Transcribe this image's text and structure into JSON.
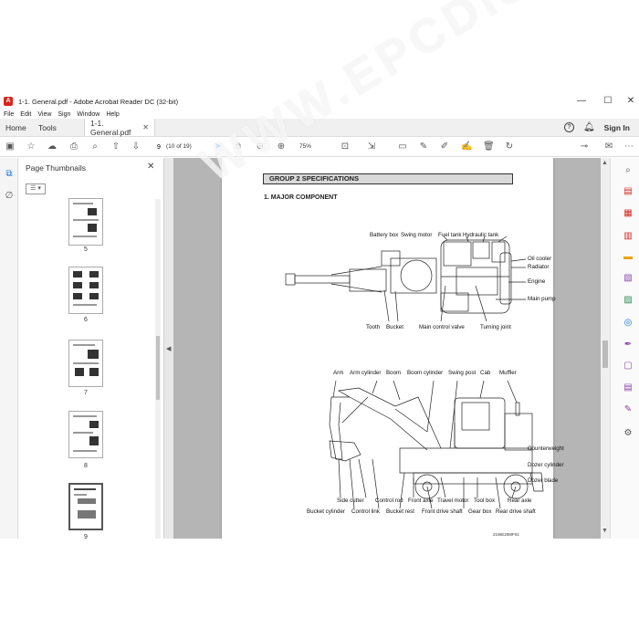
{
  "window": {
    "title": "1-1. General.pdf - Adobe Acrobat Reader DC (32-bit)",
    "app_icon": "acrobat-icon",
    "controls": [
      "—",
      "☐",
      "✕"
    ]
  },
  "menu": [
    "File",
    "Edit",
    "View",
    "Sign",
    "Window",
    "Help"
  ],
  "tabs": {
    "home": "Home",
    "tools": "Tools",
    "document": "1-1. General.pdf",
    "sign_in": "Sign In"
  },
  "toolbar": {
    "page_number": "9",
    "page_of": "(10 of 19)",
    "zoom": "75%"
  },
  "thumbnails": {
    "header": "Page Thumbnails",
    "pages": [
      {
        "label": "5"
      },
      {
        "label": "6"
      },
      {
        "label": "7"
      },
      {
        "label": "8"
      },
      {
        "label": "9"
      }
    ]
  },
  "document": {
    "group_heading": "GROUP  2  SPECIFICATIONS",
    "section_title": "1. MAJOR COMPONENT",
    "top_labels": {
      "battery_box": "Battery box",
      "swing_motor": "Swing motor",
      "fuel_tank": "Fuel tank",
      "hydraulic_tank": "Hydraulic tank",
      "oil_cooler": "Oil cooler",
      "radiator": "Radiator",
      "engine": "Engine",
      "main_pump": "Main pump",
      "tooth": "Tooth",
      "bucket": "Bucket",
      "main_control_valve": "Main control valve",
      "turning_joint": "Turning joint"
    },
    "side_labels": {
      "arm": "Arm",
      "arm_cylinder": "Arm cylinder",
      "boom": "Boom",
      "boom_cylinder": "Boom cylinder",
      "swing_post": "Swing post",
      "cab": "Cab",
      "muffler": "Muffler",
      "counterweight": "Counterweight",
      "dozer_cylinder": "Dozer cylinder",
      "dozer_blade": "Dozer blade",
      "side_cutter": "Side cutter",
      "control_rod": "Control rod",
      "front_axle": "Front axle",
      "travel_motor": "Travel motor",
      "tool_box": "Tool box",
      "rear_axle": "Rear axle",
      "bucket_cylinder": "Bucket cylinder",
      "control_link": "Control link",
      "bucket_rest": "Bucket rest",
      "front_drive_shaft": "Front drive shaft",
      "gear_box": "Gear box",
      "rear_drive_shaft": "Rear drive shaft"
    },
    "figure_code": "21WE20MF01",
    "watermark": "WWW.EPCDISC.COM"
  }
}
